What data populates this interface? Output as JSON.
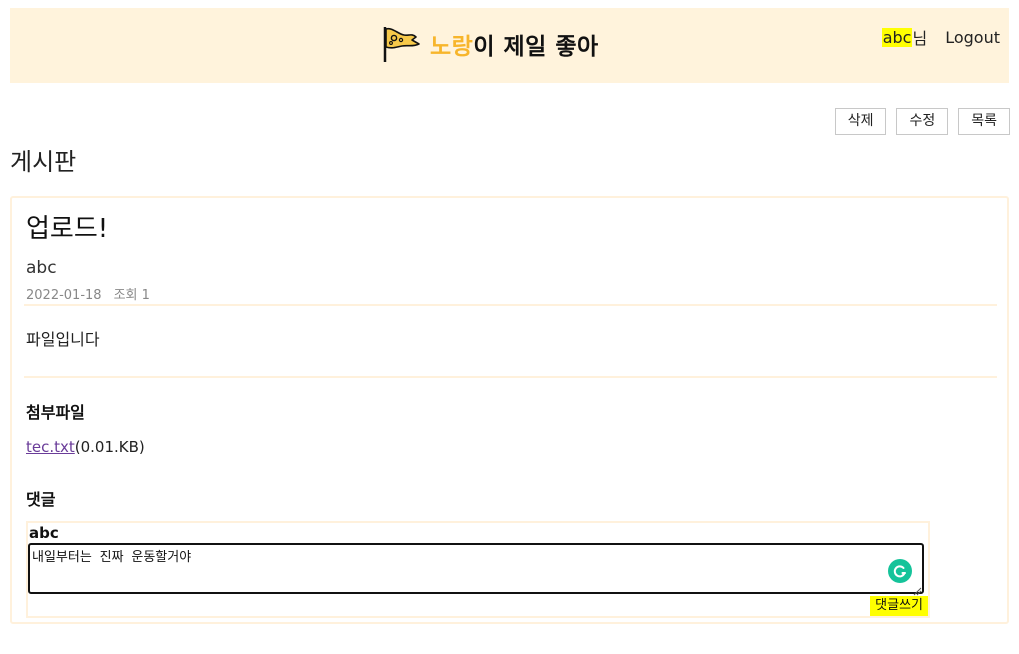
{
  "header": {
    "logo_accent": "노랑",
    "logo_rest": "이 제일 좋아",
    "username": "abc",
    "user_suffix": "님",
    "logout_label": "Logout"
  },
  "actions": {
    "delete_label": "삭제",
    "edit_label": "수정",
    "list_label": "목록"
  },
  "board": {
    "title": "게시판"
  },
  "post": {
    "title": "업로드!",
    "author": "abc",
    "date": "2022-01-18",
    "views": "조회 1",
    "body": "파일입니다"
  },
  "attachments": {
    "heading": "첨부파일",
    "file_name": "tec.txt",
    "file_size": "(0.01.KB)"
  },
  "comments": {
    "heading": "댓글",
    "commenter": "abc",
    "input_value": "내일부터는 진짜 운동할거야",
    "submit_label": "댓글쓰기"
  },
  "colors": {
    "header_bg": "#fff3dc",
    "accent_yellow": "#f7b52b",
    "highlight": "#ffff00",
    "border": "#fff1dc",
    "grammarly_green": "#15c39a",
    "link": "#6a3c99"
  },
  "icons": {
    "logo": "flag-icon",
    "grammar": "grammarly-icon",
    "resize": "resize-handle-icon"
  }
}
